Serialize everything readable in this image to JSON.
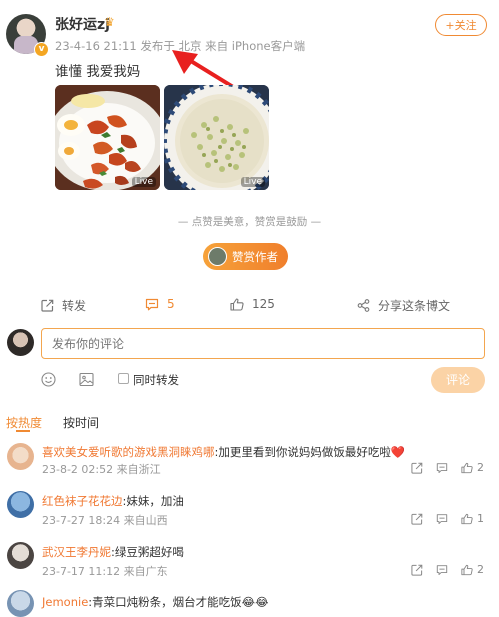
{
  "post": {
    "username": "张好运zj",
    "meta": "23-4-16 21:11  发布于 北京  来自 iPhone客户端",
    "follow_label": "+关注",
    "text": "谁懂 我爱我妈",
    "photo_live_label": "Live"
  },
  "reward": {
    "divider_text": "—  点赞是美意，赞赏是鼓励  —",
    "button_label": "赞赏作者"
  },
  "actions": {
    "repost": "转发",
    "comment_count": "5",
    "like_count": "125",
    "share": "分享这条博文"
  },
  "composer": {
    "placeholder": "发布你的评论",
    "repost_label": "同时转发",
    "submit_label": "评论"
  },
  "tabs": {
    "hot": "按热度",
    "time": "按时间"
  },
  "comments": [
    {
      "user": "喜欢美女爱听歌的游戏黑洞睐鸡哪",
      "text": ":加更里看到你说妈妈做饭最好吃啦❤️",
      "meta": "23-8-2 02:52  来自浙江",
      "likes": "2"
    },
    {
      "user": "红色袜子花花边",
      "text": ":妹妹，加油",
      "meta": "23-7-27 18:24  来自山西",
      "likes": "1"
    },
    {
      "user": "武汉王李丹妮",
      "text": ":绿豆粥超好喝",
      "meta": "23-7-17 11:12  来自广东",
      "likes": "2"
    },
    {
      "user": "Jemonie",
      "text": ":青菜口炖粉条，烟台才能吃饭😂😂",
      "meta": "",
      "likes": ""
    }
  ],
  "colors": {
    "accent": "#f08a33",
    "annotation_arrow": "#e8201f"
  }
}
